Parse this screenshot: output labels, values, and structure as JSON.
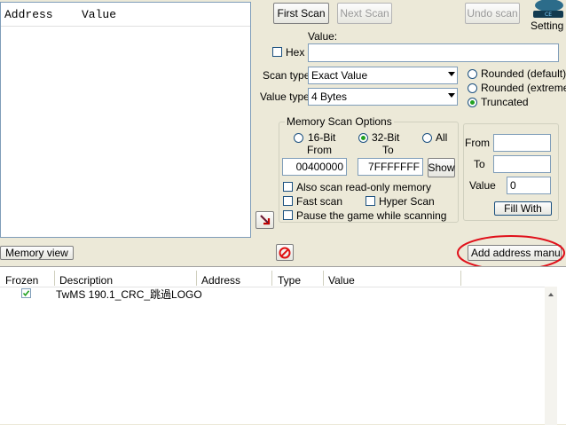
{
  "address_list": {
    "col_address": "Address",
    "col_value": "Value"
  },
  "scan_buttons": {
    "first_scan": "First Scan",
    "next_scan": "Next Scan",
    "undo_scan": "Undo scan"
  },
  "settings": {
    "label": "Setting",
    "icon": "cheat-engine-logo-icon"
  },
  "value_field": {
    "label": "Value:",
    "hex_label": "Hex",
    "hex_checked": false,
    "value": ""
  },
  "scan_type": {
    "label": "Scan type",
    "selected": "Exact Value"
  },
  "value_type": {
    "label": "Value type",
    "selected": "4 Bytes"
  },
  "rounding": {
    "options": [
      "Rounded (default)",
      "Rounded (extreme)",
      "Truncated"
    ],
    "selected_index": 2
  },
  "memory_scan": {
    "title": "Memory Scan Options",
    "bits": [
      "16-Bit",
      "32-Bit",
      "All"
    ],
    "bits_selected_index": 1,
    "from_label": "From",
    "to_label": "To",
    "from_value": "00400000",
    "to_value": "7FFFFFFF",
    "show_button": "Show",
    "also_scan_readonly": "Also scan read-only memory",
    "fast_scan": "Fast scan",
    "hyper_scan": "Hyper Scan",
    "pause_game": "Pause the game while scanning"
  },
  "fill_panel": {
    "from_label": "From",
    "to_label": "To",
    "value_label": "Value",
    "value": "0",
    "fill_button": "Fill With"
  },
  "bottom_bar": {
    "memory_view": "Memory view",
    "add_address_manually": "Add address manually"
  },
  "cheat_table": {
    "columns": [
      "Frozen",
      "Description",
      "Address",
      "Type",
      "Value"
    ],
    "rows": [
      {
        "frozen": true,
        "description": "TwMS 190.1_CRC_跳過LOGO",
        "address": "",
        "type": "",
        "value": ""
      }
    ]
  },
  "colors": {
    "highlight_ellipse": "#e0101a",
    "accent_green": "#21a121"
  }
}
